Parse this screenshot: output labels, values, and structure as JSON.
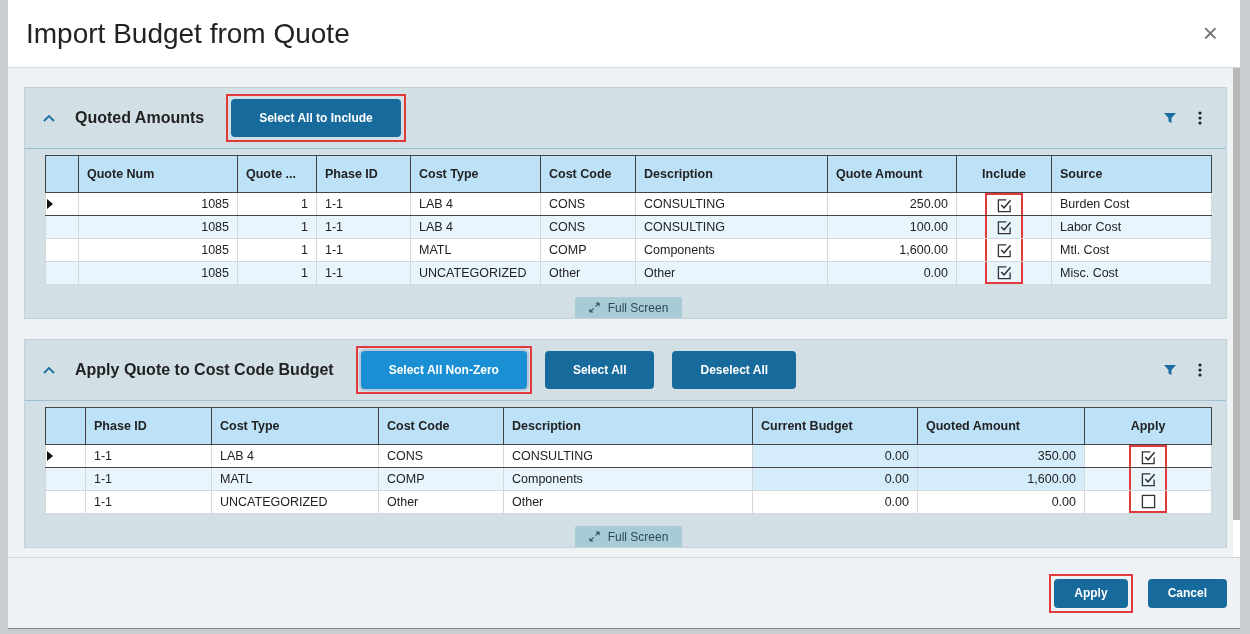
{
  "dialog": {
    "title": "Import Budget from Quote",
    "close": "×"
  },
  "panels": [
    {
      "title": "Quoted Amounts",
      "expanded": true,
      "buttons": [
        {
          "label": "Select All to Include",
          "highlighted": true,
          "focused": false
        }
      ],
      "columns": [
        {
          "kind": "indicator"
        },
        {
          "label": "Quote Num",
          "kind": "text"
        },
        {
          "label": "Quote ...",
          "kind": "text"
        },
        {
          "label": "Phase ID",
          "kind": "text"
        },
        {
          "label": "Cost Type",
          "kind": "text"
        },
        {
          "label": "Cost Code",
          "kind": "text"
        },
        {
          "label": "Description",
          "kind": "text"
        },
        {
          "label": "Quote Amount",
          "kind": "text"
        },
        {
          "label": "Include",
          "kind": "checkbox",
          "highlighted": true
        },
        {
          "label": "Source",
          "kind": "text"
        }
      ],
      "rows": [
        {
          "current": true,
          "cells": [
            "",
            "1085",
            "1",
            "1-1",
            "LAB 4",
            "CONS",
            "CONSULTING",
            "250.00",
            true,
            "Burden Cost"
          ]
        },
        {
          "current": false,
          "cells": [
            "",
            "1085",
            "1",
            "1-1",
            "LAB 4",
            "CONS",
            "CONSULTING",
            "100.00",
            true,
            "Labor Cost"
          ]
        },
        {
          "current": false,
          "cells": [
            "",
            "1085",
            "1",
            "1-1",
            "MATL",
            "COMP",
            "Components",
            "1,600.00",
            true,
            "Mtl. Cost"
          ]
        },
        {
          "current": false,
          "cells": [
            "",
            "1085",
            "1",
            "1-1",
            "UNCATEGORIZED",
            "Other",
            "Other",
            "0.00",
            true,
            "Misc. Cost"
          ]
        }
      ],
      "full_screen": "Full Screen"
    },
    {
      "title": "Apply Quote to Cost Code Budget",
      "expanded": true,
      "buttons": [
        {
          "label": "Select All Non-Zero",
          "highlighted": true,
          "focused": true
        },
        {
          "label": "Select All",
          "highlighted": false,
          "focused": false
        },
        {
          "label": "Deselect All",
          "highlighted": false,
          "focused": false
        }
      ],
      "columns": [
        {
          "kind": "indicator"
        },
        {
          "label": "Phase ID",
          "kind": "text"
        },
        {
          "label": "Cost Type",
          "kind": "text"
        },
        {
          "label": "Cost Code",
          "kind": "text"
        },
        {
          "label": "Description",
          "kind": "text"
        },
        {
          "label": "Current Budget",
          "kind": "amount"
        },
        {
          "label": "Quoted Amount",
          "kind": "amount"
        },
        {
          "label": "Apply",
          "kind": "checkbox",
          "highlighted": true
        }
      ],
      "rows": [
        {
          "current": true,
          "cells": [
            "",
            "1-1",
            "LAB 4",
            "CONS",
            "CONSULTING",
            "0.00",
            "350.00",
            true
          ]
        },
        {
          "current": false,
          "cells": [
            "",
            "1-1",
            "MATL",
            "COMP",
            "Components",
            "0.00",
            "1,600.00",
            true
          ]
        },
        {
          "current": false,
          "cells": [
            "",
            "1-1",
            "UNCATEGORIZED",
            "Other",
            "Other",
            "0.00",
            "0.00",
            false
          ]
        }
      ],
      "full_screen": "Full Screen"
    }
  ],
  "footer": {
    "buttons": [
      {
        "label": "Apply",
        "highlighted": true
      },
      {
        "label": "Cancel",
        "highlighted": false
      }
    ]
  }
}
